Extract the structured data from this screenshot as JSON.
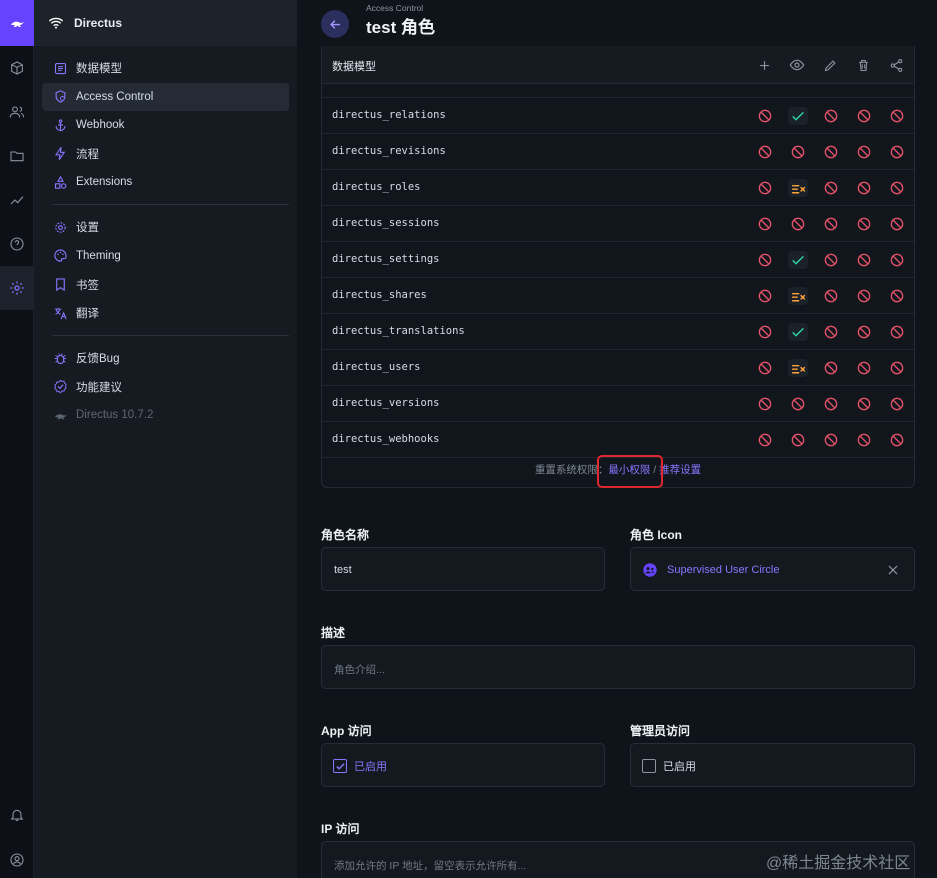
{
  "project": {
    "name": "Directus"
  },
  "nav": {
    "group1": [
      {
        "label": "数据模型",
        "icon": "data-model-icon"
      },
      {
        "label": "Access Control",
        "icon": "access-control-icon",
        "active": true
      },
      {
        "label": "Webhook",
        "icon": "anchor-icon"
      },
      {
        "label": "流程",
        "icon": "bolt-icon"
      },
      {
        "label": "Extensions",
        "icon": "extensions-icon"
      }
    ],
    "group2": [
      {
        "label": "设置",
        "icon": "gear-icon"
      },
      {
        "label": "Theming",
        "icon": "palette-icon"
      },
      {
        "label": "书签",
        "icon": "bookmark-icon"
      },
      {
        "label": "翻译",
        "icon": "translate-icon"
      }
    ],
    "group3": [
      {
        "label": "反馈Bug",
        "icon": "bug-icon"
      },
      {
        "label": "功能建议",
        "icon": "verified-icon"
      }
    ],
    "version": "Directus 10.7.2"
  },
  "header": {
    "breadcrumb": "Access Control",
    "title": "test 角色"
  },
  "permissions": {
    "header_label": "数据模型",
    "columns": [
      "create",
      "read",
      "update",
      "delete",
      "share"
    ],
    "rows": [
      {
        "name": "directus_relations",
        "cells": [
          "none",
          "all",
          "none",
          "none",
          "none"
        ]
      },
      {
        "name": "directus_revisions",
        "cells": [
          "none",
          "none",
          "none",
          "none",
          "none"
        ]
      },
      {
        "name": "directus_roles",
        "cells": [
          "none",
          "partial",
          "none",
          "none",
          "none"
        ]
      },
      {
        "name": "directus_sessions",
        "cells": [
          "none",
          "none",
          "none",
          "none",
          "none"
        ]
      },
      {
        "name": "directus_settings",
        "cells": [
          "none",
          "all",
          "none",
          "none",
          "none"
        ]
      },
      {
        "name": "directus_shares",
        "cells": [
          "none",
          "partial",
          "none",
          "none",
          "none"
        ]
      },
      {
        "name": "directus_translations",
        "cells": [
          "none",
          "all",
          "none",
          "none",
          "none"
        ]
      },
      {
        "name": "directus_users",
        "cells": [
          "none",
          "partial",
          "none",
          "none",
          "none"
        ]
      },
      {
        "name": "directus_versions",
        "cells": [
          "none",
          "none",
          "none",
          "none",
          "none"
        ]
      },
      {
        "name": "directus_webhooks",
        "cells": [
          "none",
          "none",
          "none",
          "none",
          "none"
        ]
      }
    ],
    "reset_prefix": "重置系统权限：",
    "reset_min": "最小权限",
    "reset_sep": " / ",
    "reset_recommended": "推荐设置"
  },
  "form": {
    "role_name_label": "角色名称",
    "role_name_value": "test",
    "role_icon_label": "角色 Icon",
    "role_icon_value": "Supervised User Circle",
    "description_label": "描述",
    "description_placeholder": "角色介绍...",
    "app_access_label": "App 访问",
    "app_access_value": "已启用",
    "app_access_checked": true,
    "admin_access_label": "管理员访问",
    "admin_access_value": "已启用",
    "admin_access_checked": false,
    "ip_label": "IP 访问",
    "ip_placeholder": "添加允许的 IP 地址，留空表示允许所有..."
  },
  "watermark": "@稀土掘金技术社区",
  "colors": {
    "accent": "#6644ff",
    "danger": "#e35169",
    "success": "#2ecda7",
    "warning": "#ffa439"
  }
}
